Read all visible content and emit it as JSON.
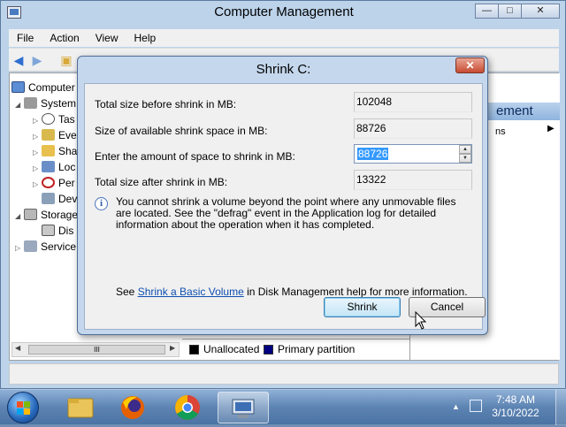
{
  "window": {
    "title": "Computer Management",
    "controls": {
      "minimize": "—",
      "maximize": "□",
      "close": "✕"
    }
  },
  "menu": [
    "File",
    "Action",
    "View",
    "Help"
  ],
  "tree": {
    "root": "Computer",
    "items": [
      {
        "label": "System",
        "icon": "tools-icon"
      },
      {
        "label": "Tas",
        "icon": "clock-icon"
      },
      {
        "label": "Eve",
        "icon": "event-icon"
      },
      {
        "label": "Sha",
        "icon": "folder-icon"
      },
      {
        "label": "Loc",
        "icon": "users-icon"
      },
      {
        "label": "Per",
        "icon": "performance-icon"
      },
      {
        "label": "Dev",
        "icon": "device-icon"
      },
      {
        "label": "Storage",
        "icon": "storage-icon"
      },
      {
        "label": "Dis",
        "icon": "disk-icon"
      },
      {
        "label": "Service",
        "icon": "services-icon"
      }
    ],
    "hscroll_grip": "III"
  },
  "actions": {
    "header": "ement",
    "item": "ns"
  },
  "legend": [
    {
      "label": "Unallocated",
      "color": "#000000"
    },
    {
      "label": "Primary partition",
      "color": "#000080"
    }
  ],
  "dialog": {
    "title": "Shrink C:",
    "close": "✕",
    "fields": {
      "total_before_label": "Total size before shrink in MB:",
      "total_before_value": "102048",
      "available_label": "Size of available shrink space in MB:",
      "available_value": "88726",
      "amount_label": "Enter the amount of space to shrink in MB:",
      "amount_value": "88726",
      "total_after_label": "Total size after shrink in MB:",
      "total_after_value": "13322"
    },
    "info_text": "You cannot shrink a volume beyond the point where any unmovable files are located. See the \"defrag\" event in the Application log for detailed information about the operation when it has completed.",
    "help_prefix": "See ",
    "help_link": "Shrink a Basic Volume",
    "help_suffix": " in Disk Management help for more information.",
    "buttons": {
      "shrink": "Shrink",
      "cancel": "Cancel"
    }
  },
  "taskbar": {
    "time": "7:48 AM",
    "date": "3/10/2022"
  }
}
